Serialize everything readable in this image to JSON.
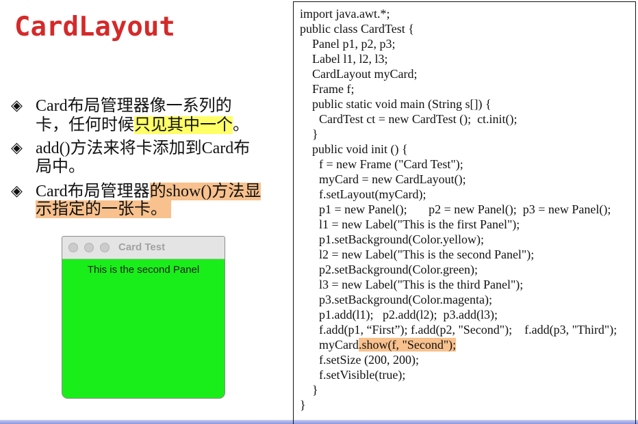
{
  "slide": {
    "title": "CardLayout",
    "bullet_symbol": "◈",
    "bullet_icon": "diamond-bullet-icon",
    "bullets": [
      {
        "lines": [
          [
            "Card布局管理器像一系列的"
          ],
          [
            "卡，任何时候",
            "只见其中一个",
            "。"
          ]
        ]
      },
      {
        "lines": [
          [
            "add()方法来将卡添加到Card布"
          ],
          [
            "局中。"
          ]
        ]
      },
      {
        "lines": [
          [
            "Card布局管理器",
            "的show()方法显"
          ],
          [
            "示指定的一张卡。 "
          ]
        ]
      }
    ]
  },
  "window": {
    "title": "Card Test",
    "label": "This is the second Panel",
    "controls": [
      "close-icon",
      "minimize-icon",
      "zoom-icon"
    ]
  },
  "code": {
    "lines": [
      "import java.awt.*;",
      "public class CardTest {",
      "Panel p1, p2, p3;",
      "Label l1, l2, l3;",
      "CardLayout myCard;",
      "Frame f;",
      "public static void main (String s[]) {",
      "CardTest ct = new CardTest ();  ct.init();",
      "}",
      "public void init () {",
      "f = new Frame (\"Card Test\");",
      "myCard = new CardLayout();",
      "f.setLayout(myCard);",
      "p1 = new Panel();       p2 = new Panel();  p3 = new Panel();",
      "l1 = new Label(\"This is the first Panel\");",
      "p1.setBackground(Color.yellow);",
      "l2 = new Label(\"This is the second Panel\");",
      "p2.setBackground(Color.green);",
      "l3 = new Label(\"This is the third Panel\");",
      "p3.setBackground(Color.magenta);",
      "p1.add(l1);   p2.add(l2);  p3.add(l3);",
      "f.add(p1, “First”); f.add(p2, \"Second\");    f.add(p3, \"Third\");",
      [
        "myCard",
        ".show(f, \"Second\");"
      ],
      "f.setSize (200, 200);",
      "f.setVisible(true);",
      "}",
      "}"
    ]
  },
  "colors": {
    "title": "#d42a2a",
    "highlight_yellow": "#ffff66",
    "highlight_orange": "#f8c18d",
    "panel_green": "#1aee1a",
    "bottom_bar": "#8c95dd"
  }
}
